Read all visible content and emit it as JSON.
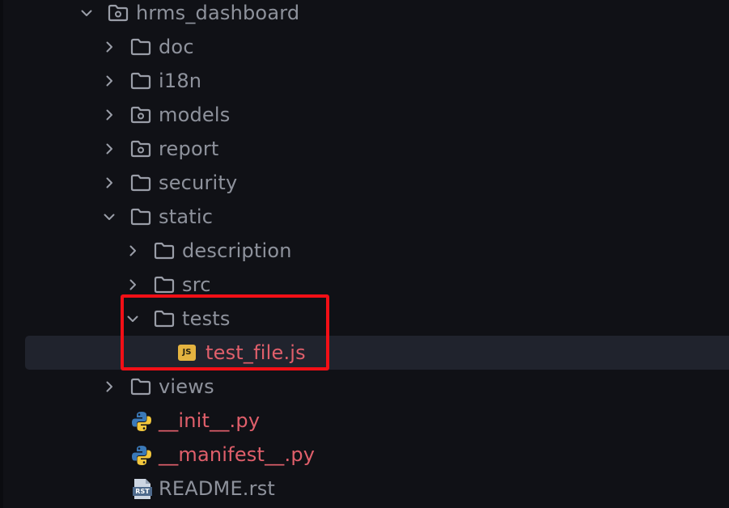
{
  "explorer": {
    "root": {
      "label": "hrms_dashboard",
      "icon": "folder-gear-icon",
      "state": "expanded"
    },
    "items": [
      {
        "label": "doc",
        "icon": "folder-icon",
        "state": "collapsed"
      },
      {
        "label": "i18n",
        "icon": "folder-icon",
        "state": "collapsed"
      },
      {
        "label": "models",
        "icon": "folder-gear-icon",
        "state": "collapsed"
      },
      {
        "label": "report",
        "icon": "folder-gear-icon",
        "state": "collapsed"
      },
      {
        "label": "security",
        "icon": "folder-icon",
        "state": "collapsed"
      },
      {
        "label": "static",
        "icon": "folder-icon",
        "state": "expanded"
      },
      {
        "label": "description",
        "icon": "folder-icon",
        "state": "collapsed"
      },
      {
        "label": "src",
        "icon": "folder-icon",
        "state": "collapsed"
      },
      {
        "label": "tests",
        "icon": "folder-icon",
        "state": "expanded"
      },
      {
        "label": "test_file.js",
        "icon": "javascript-file-icon",
        "badge": "JS",
        "selected": true
      },
      {
        "label": "views",
        "icon": "folder-icon",
        "state": "collapsed"
      },
      {
        "label": "__init__.py",
        "icon": "python-file-icon"
      },
      {
        "label": "__manifest__.py",
        "icon": "python-file-icon"
      },
      {
        "label": "README.rst",
        "icon": "rst-file-icon",
        "badge": "RST"
      }
    ]
  },
  "colors": {
    "background": "#101116",
    "text": "#8e929c",
    "modified_text": "#e05f6b",
    "selected_row": "#20232d",
    "highlight_box": "#f20f16",
    "js_badge": "#e4b340"
  }
}
